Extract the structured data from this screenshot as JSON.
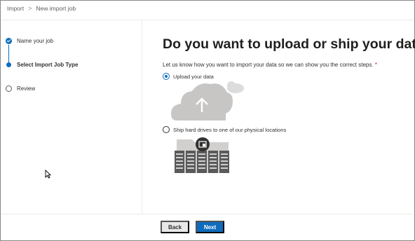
{
  "breadcrumb": {
    "items": [
      "Import",
      "New import job"
    ],
    "separator": ">"
  },
  "steps": [
    {
      "label": "Name your job",
      "state": "done"
    },
    {
      "label": "Select Import Job Type",
      "state": "current"
    },
    {
      "label": "Review",
      "state": "pending"
    }
  ],
  "main": {
    "heading": "Do you want to upload or ship your data?",
    "description": "Let us know how you want to import your data so we can show you the correct steps.",
    "required_marker": "*",
    "options": [
      {
        "label": "Upload your data",
        "selected": true,
        "icon": "cloud-upload-icon"
      },
      {
        "label": "Ship hard drives to one of our physical locations",
        "selected": false,
        "icon": "hard-drives-icon"
      }
    ]
  },
  "footer": {
    "back_label": "Back",
    "next_label": "Next"
  },
  "colors": {
    "accent": "#0f6cbd",
    "text": "#323130",
    "border": "#edebe9",
    "illustration": "#c8c6c4"
  }
}
